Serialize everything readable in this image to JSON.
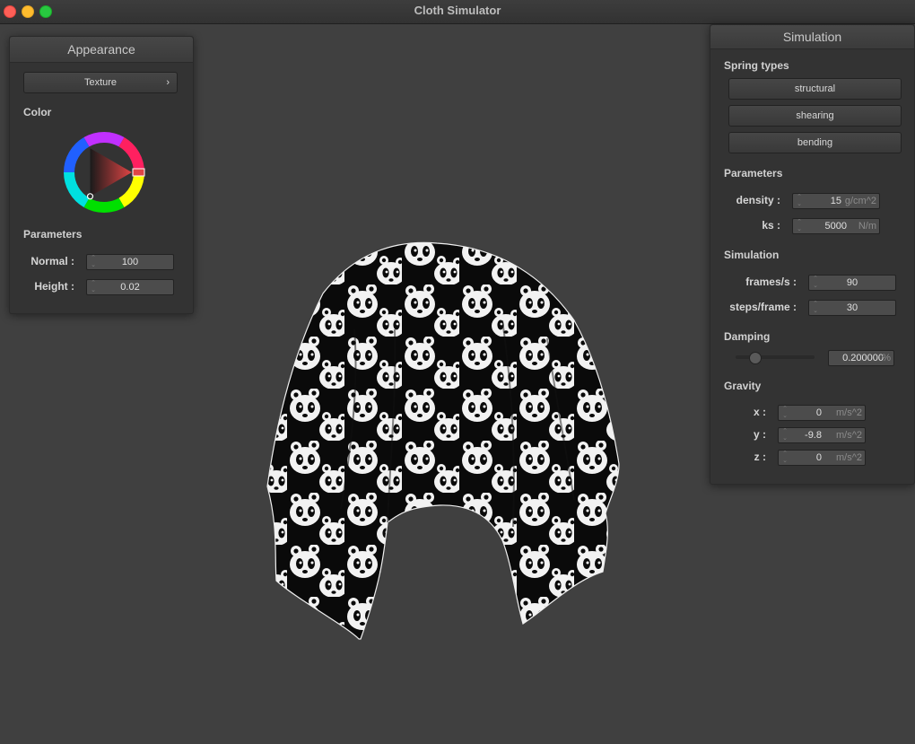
{
  "window": {
    "title": "Cloth Simulator"
  },
  "appearance": {
    "header": "Appearance",
    "texture_button": "Texture",
    "texture_arrow": "›",
    "color_label": "Color",
    "parameters_label": "Parameters",
    "normal_label": "Normal :",
    "normal_value": "100",
    "height_label": "Height :",
    "height_value": "0.02"
  },
  "simulation": {
    "header": "Simulation",
    "spring_types_label": "Spring types",
    "structural": "structural",
    "shearing": "shearing",
    "bending": "bending",
    "parameters_label": "Parameters",
    "density_label": "density :",
    "density_value": "15",
    "density_unit": "g/cm^2",
    "ks_label": "ks :",
    "ks_value": "5000",
    "ks_unit": "N/m",
    "sim_label": "Simulation",
    "fps_label": "frames/s :",
    "fps_value": "90",
    "steps_label": "steps/frame :",
    "steps_value": "30",
    "damping_label": "Damping",
    "damping_value": "0.200000",
    "damping_unit": "%",
    "damping_slider_fraction": 0.2,
    "gravity_label": "Gravity",
    "gx_label": "x :",
    "gx_value": "0",
    "gy_label": "y :",
    "gy_value": "-9.8",
    "gz_label": "z :",
    "gz_value": "0",
    "g_unit": "m/s^2"
  },
  "colors": {
    "background": "#404040",
    "panel": "#333333",
    "selected_hue": "#e04545"
  }
}
